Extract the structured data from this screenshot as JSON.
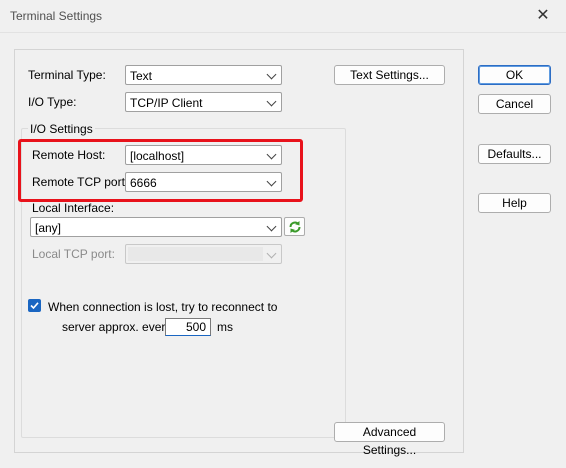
{
  "window": {
    "title": "Terminal Settings"
  },
  "fields": {
    "terminal_type": {
      "label": "Terminal Type:",
      "value": "Text"
    },
    "io_type": {
      "label": "I/O Type:",
      "value": "TCP/IP Client"
    },
    "io_settings_group": "I/O Settings",
    "remote_host": {
      "label": "Remote Host:",
      "value": "[localhost]"
    },
    "remote_tcp_port": {
      "label": "Remote TCP port:",
      "value": "6666"
    },
    "local_interface": {
      "label": "Local Interface:",
      "value": "[any]"
    },
    "local_tcp_port": {
      "label": "Local TCP port:",
      "value": ""
    },
    "reconnect": {
      "checked": true,
      "line1": "When connection is lost, try to reconnect to",
      "line2": "server approx. every",
      "seconds": "500",
      "unit": "ms"
    }
  },
  "buttons": {
    "text_settings": "Text Settings...",
    "advanced_settings": "Advanced Settings...",
    "ok": "OK",
    "cancel": "Cancel",
    "defaults": "Defaults...",
    "help": "Help"
  },
  "colors": {
    "highlight": "#e8121b",
    "accent": "#1a66c2"
  }
}
